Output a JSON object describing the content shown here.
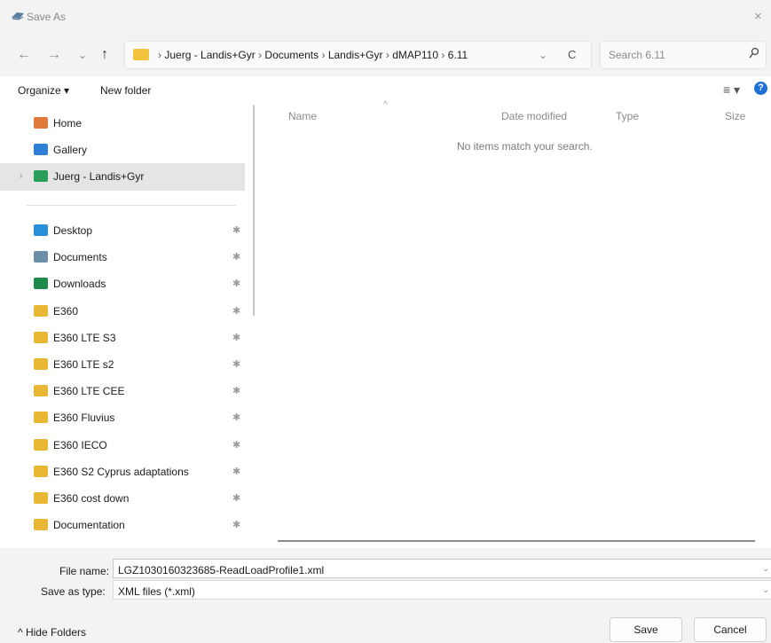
{
  "window": {
    "title": "Save As",
    "close": "×"
  },
  "nav": {
    "back": "←",
    "forward": "→",
    "recent": "⌄",
    "up": "↑",
    "refresh": "C",
    "dropdown": "⌄"
  },
  "breadcrumb": [
    "Juerg - Landis+Gyr",
    "Documents",
    "Landis+Gyr",
    "dMAP110",
    "6.11"
  ],
  "breadcrumb_sep": "›",
  "search": {
    "placeholder": "Search 6.11"
  },
  "toolbar": {
    "organize": "Organize ▾",
    "new_folder": "New folder",
    "view": "≡ ▾",
    "help": "?"
  },
  "sidebar": {
    "top_items": [
      {
        "label": "Home",
        "icon": "home-icon",
        "color": "#e07a3a"
      },
      {
        "label": "Gallery",
        "icon": "gallery-icon",
        "color": "#2f7fd6"
      },
      {
        "label": "Juerg - Landis+Gyr",
        "icon": "onedrive-icon",
        "color": "#2a9d5b"
      }
    ],
    "pinned_items": [
      {
        "label": "Desktop",
        "icon": "desktop-icon",
        "color": "#2a8fd9"
      },
      {
        "label": "Documents",
        "icon": "documents-icon",
        "color": "#6b8fa8"
      },
      {
        "label": "Downloads",
        "icon": "downloads-icon",
        "color": "#1e8a4a"
      },
      {
        "label": "E360",
        "icon": "folder-icon",
        "color": "#e8b733"
      },
      {
        "label": "E360 LTE S3",
        "icon": "folder-icon",
        "color": "#e8b733"
      },
      {
        "label": "E360 LTE s2",
        "icon": "folder-icon",
        "color": "#e8b733"
      },
      {
        "label": "E360 LTE CEE",
        "icon": "folder-icon",
        "color": "#e8b733"
      },
      {
        "label": "E360 Fluvius",
        "icon": "folder-icon",
        "color": "#e8b733"
      },
      {
        "label": "E360 IECO",
        "icon": "folder-icon",
        "color": "#e8b733"
      },
      {
        "label": "E360 S2 Cyprus adaptations",
        "icon": "folder-icon",
        "color": "#e8b733"
      },
      {
        "label": "E360 cost down",
        "icon": "folder-icon",
        "color": "#e8b733"
      },
      {
        "label": "Documentation",
        "icon": "folder-icon",
        "color": "#e8b733"
      }
    ],
    "pin_glyph": "✱"
  },
  "filelist": {
    "columns": [
      "Name",
      "Date modified",
      "Type",
      "Size"
    ],
    "sort_glyph": "^",
    "empty_message": "No items match your search."
  },
  "form": {
    "file_name_label": "File name:",
    "file_name_value": "LGZ1030160323685-ReadLoadProfile1.xml",
    "save_type_label": "Save as type:",
    "save_type_value": "XML files (*.xml)",
    "dropdown_glyph": "⌄"
  },
  "footer": {
    "hide_folders": "^ Hide Folders",
    "save": "Save",
    "cancel": "Cancel"
  }
}
